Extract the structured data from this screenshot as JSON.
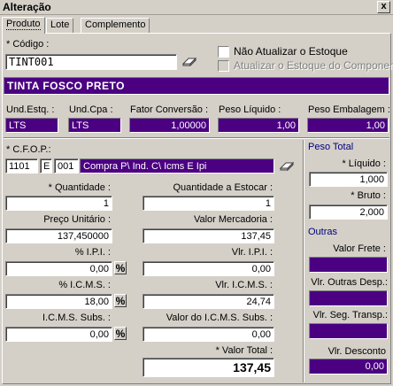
{
  "window": {
    "title": "Alteração",
    "close_glyph": "x"
  },
  "tabs": [
    {
      "label": "Produto"
    },
    {
      "label": "Lote"
    },
    {
      "label": "Complemento"
    }
  ],
  "produto": {
    "codigo_label": "* Código :",
    "codigo_value": "TINT001",
    "nao_atualizar_label": "Não Atualizar o Estoque",
    "atualizar_componente_label": "Atualizar o  Estoque do Componente",
    "descricao": "TINTA FOSCO PRETO"
  },
  "unidades": {
    "und_estq_label": "Und.Estq. :",
    "und_estq_value": "LTS",
    "und_cpa_label": "Und.Cpa :",
    "und_cpa_value": "LTS",
    "fator_label": "Fator Conversão :",
    "fator_value": "1,00000",
    "peso_liquido_label": "Peso Líquido :",
    "peso_liquido_value": "1,00",
    "peso_embalagem_label": "Peso Embalagem :",
    "peso_embalagem_value": "1,00"
  },
  "cfop": {
    "label": "* C.F.O.P.:",
    "code": "1101",
    "letter": "E",
    "seq": "001",
    "description": "Compra P\\ Ind. C\\ Icms E Ipi"
  },
  "valores": {
    "quantidade_label": "* Quantidade :",
    "quantidade_value": "1",
    "quantidade_estocar_label": "Quantidade a Estocar :",
    "quantidade_estocar_value": "1",
    "preco_unitario_label": "Preço Unitário :",
    "preco_unitario_value": "137,450000",
    "valor_mercadoria_label": "Valor Mercadoria :",
    "valor_mercadoria_value": "137,45",
    "pct_ipi_label": "% I.P.I. :",
    "pct_ipi_value": "0,00",
    "vlr_ipi_label": "Vlr. I.P.I. :",
    "vlr_ipi_value": "0,00",
    "pct_icms_label": "% I.C.M.S. :",
    "pct_icms_value": "18,00",
    "vlr_icms_label": "Vlr. I.C.M.S. :",
    "vlr_icms_value": "24,74",
    "icms_subs_label": "I.C.M.S. Subs. :",
    "icms_subs_value": "0,00",
    "valor_icms_subs_label": "Valor do I.C.M.S. Subs. :",
    "valor_icms_subs_value": "0,00",
    "valor_total_label": "* Valor Total :",
    "valor_total_value": "137,45",
    "pct_symbol": "%"
  },
  "peso_total": {
    "header": "Peso Total",
    "liquido_label": "* Líquido :",
    "liquido_value": "1,000",
    "bruto_label": "* Bruto :",
    "bruto_value": "2,000"
  },
  "outras": {
    "header": "Outras",
    "valor_frete_label": "Valor Frete :",
    "valor_frete_value": "",
    "outras_desp_label": "Vlr. Outras Desp.:",
    "outras_desp_value": "",
    "seg_transp_label": "Vlr. Seg. Transp.:",
    "seg_transp_value": "",
    "desconto_label": "Vlr. Desconto",
    "desconto_value": "0,00"
  },
  "colors": {
    "accent": "#4b0082",
    "face": "#d4d0c8",
    "header_text": "#000080"
  }
}
